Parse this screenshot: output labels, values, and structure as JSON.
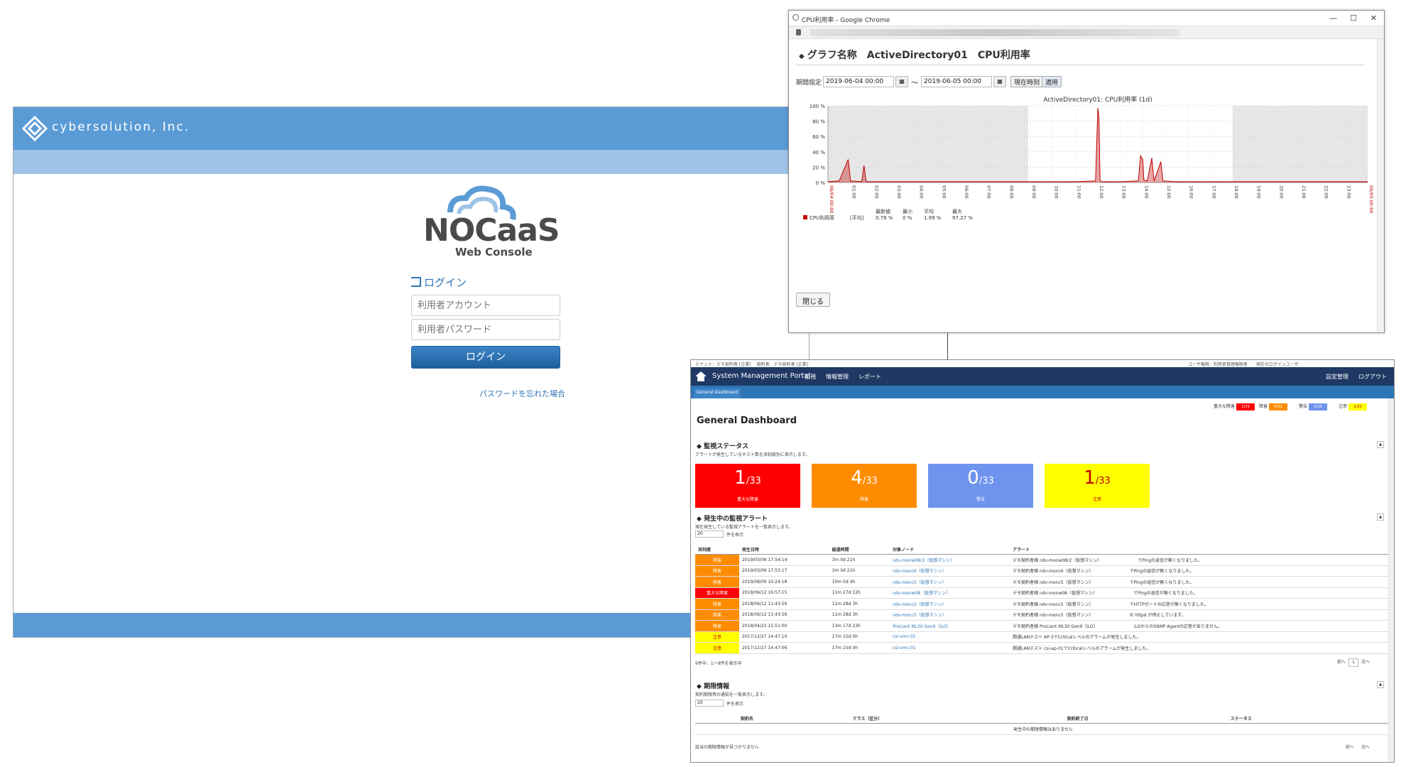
{
  "login": {
    "brand": "cybersolution, Inc.",
    "product": "NOCaaS",
    "product_sub": "Web Console",
    "heading": "ログイン",
    "account_placeholder": "利用者アカウント",
    "password_placeholder": "利用者パスワード",
    "login_button": "ログイン",
    "forgot_link": "パスワードを忘れた場合"
  },
  "popup": {
    "window_title": "CPU利用率 - Google Chrome",
    "heading": "グラフ名称　ActiveDirectory01　CPU利用率",
    "period_label": "期間指定",
    "from": "2019-06-04 00:00",
    "to": "2019-06-05 00:00",
    "tilde": "～",
    "now_button": "現在時刻",
    "apply_button": "適用",
    "close_button": "閉じる",
    "controls": {
      "minimize": "—",
      "maximize": "☐",
      "close": "✕"
    }
  },
  "chart_data": {
    "type": "line",
    "title": "ActiveDirectory01: CPU利用率 (1d)",
    "x": [
      "06/04 00:00",
      "01:00",
      "02:00",
      "03:00",
      "04:00",
      "05:00",
      "06:00",
      "07:00",
      "08:00",
      "09:00",
      "10:00",
      "11:00",
      "12:00",
      "13:00",
      "14:00",
      "15:00",
      "16:00",
      "17:00",
      "18:00",
      "19:00",
      "20:00",
      "21:00",
      "22:00",
      "23:00",
      "06/05 00:00"
    ],
    "yticks": [
      "0 %",
      "20 %",
      "40 %",
      "60 %",
      "80 %",
      "100 %"
    ],
    "ylim": [
      0,
      100
    ],
    "legend": {
      "series": "CPU利用率",
      "agg": "[平均]",
      "headers": [
        "最新値",
        "最小",
        "平均",
        "最大"
      ],
      "values": [
        "0.78 %",
        "0 %",
        "1.99 %",
        "97.27 %"
      ]
    },
    "series": [
      {
        "name": "CPU利用率",
        "color": "#c00000",
        "points": [
          [
            0,
            1
          ],
          [
            0.5,
            2
          ],
          [
            0.9,
            30
          ],
          [
            1.0,
            2
          ],
          [
            1.5,
            1
          ],
          [
            1.6,
            22
          ],
          [
            1.7,
            1
          ],
          [
            2,
            1
          ],
          [
            3,
            1
          ],
          [
            4,
            1
          ],
          [
            5,
            1
          ],
          [
            6,
            1
          ],
          [
            7,
            1
          ],
          [
            8,
            1
          ],
          [
            9,
            1
          ],
          [
            10,
            1
          ],
          [
            11,
            1
          ],
          [
            11.9,
            2
          ],
          [
            12.0,
            97
          ],
          [
            12.05,
            85
          ],
          [
            12.1,
            2
          ],
          [
            12.2,
            1
          ],
          [
            13,
            1
          ],
          [
            13.8,
            2
          ],
          [
            13.9,
            35
          ],
          [
            14.0,
            30
          ],
          [
            14.05,
            3
          ],
          [
            14.2,
            2
          ],
          [
            14.4,
            32
          ],
          [
            14.5,
            2
          ],
          [
            14.8,
            27
          ],
          [
            14.9,
            2
          ],
          [
            15.5,
            1
          ],
          [
            16,
            1
          ],
          [
            17,
            1
          ],
          [
            18,
            1
          ],
          [
            19,
            1
          ],
          [
            20,
            1
          ],
          [
            21,
            1
          ],
          [
            22,
            1
          ],
          [
            23,
            1
          ],
          [
            24,
            1
          ]
        ]
      }
    ],
    "shaded_ranges": [
      [
        0,
        8.9
      ],
      [
        18,
        24
      ]
    ]
  },
  "dashboard": {
    "topinfo_left": "テナント：デモ契約者 [企業] 　契約者：デモ契約者 [企業]",
    "topinfo_right": "ユーザ権限：利用者管理権限者　　現在のログインユーザ",
    "portal_title": "System Management Portal",
    "menu": [
      "監視",
      "情報管理",
      "レポート"
    ],
    "menu_right": [
      "設定管理",
      "ログアウト"
    ],
    "tab": "General Dashboard",
    "legend": [
      {
        "label": "重大な障害",
        "value": "1/33",
        "color": "#ff0000",
        "text": "#fff"
      },
      {
        "label": "障害",
        "value": "4/33",
        "color": "#ff8c00",
        "text": "#fff"
      },
      {
        "label": "警告",
        "value": "0/33",
        "color": "#6f94ee",
        "text": "#fff"
      },
      {
        "label": "注意",
        "value": "1/33",
        "color": "#ffff00",
        "text": "#c00000"
      }
    ],
    "title": "General Dashboard",
    "status_section": "監視ステータス",
    "status_note": "アラートが発生しているホスト数を深刻度別に表示します。",
    "kpis": [
      {
        "num": "1",
        "den": "/33",
        "label": "重大な障害",
        "color": "#ff0000",
        "text": "#ffffff"
      },
      {
        "num": "4",
        "den": "/33",
        "label": "障害",
        "color": "#ff8c00",
        "text": "#ffffff"
      },
      {
        "num": "0",
        "den": "/33",
        "label": "警告",
        "color": "#6f94ee",
        "text": "#ffffff"
      },
      {
        "num": "1",
        "den": "/33",
        "label": "注意",
        "color": "#ffff00",
        "text": "#c00000"
      }
    ],
    "alerts_section": "発生中の監視アラート",
    "alerts_note": "現在発生している監視アラートを一覧表示します。",
    "select_value": "20",
    "select_note": "件を表示",
    "alert_headers": [
      "深刻度",
      "発生日時",
      "経過時間",
      "対象ノード",
      "アラート"
    ],
    "alerts": [
      {
        "sev": "障害",
        "color": "#ff8c00",
        "text": "#fff",
        "date": "2019/03/06 17:54:14",
        "elapsed": "3m 0d 21h",
        "node": "ndv-monw08r2（仮想マシン）",
        "alert": "デモ契約者様 ndv-monw08r2（仮想マシン）　　　　　　　　　でPingの返信が無くなりました。"
      },
      {
        "sev": "障害",
        "color": "#ff8c00",
        "text": "#fff",
        "date": "2019/03/06 17:53:17",
        "elapsed": "3m 0d 21h",
        "node": "ndv-monc6（仮想マシン）",
        "alert": "デモ契約者様 ndv-monc6（仮想マシン）　　　　　　　　　でPingの返信が無くなりました。"
      },
      {
        "sev": "障害",
        "color": "#ff8c00",
        "text": "#fff",
        "date": "2019/08/09 10:24:18",
        "elapsed": "10m 0d 4h",
        "node": "ndv-monc5（仮想マシン）",
        "alert": "デモ契約者様 ndv-monc5（仮想マシン）　　　　　　　　　でPingの返信が無くなりました。"
      },
      {
        "sev": "重大な障害",
        "color": "#ff0000",
        "text": "#fff",
        "date": "2018/06/12 16:57:15",
        "elapsed": "11m 27d 22h",
        "node": "ndv-monw08（仮想マシン）",
        "alert": "デモ契約者様 ndv-monw08（仮想マシン）　　　　　　　　　でPingの返信が無くなりました。"
      },
      {
        "sev": "障害",
        "color": "#ff8c00",
        "text": "#fff",
        "date": "2018/06/12 11:43:56",
        "elapsed": "11m 28d 3h",
        "node": "ndv-monc5（仮想マシン）",
        "alert": "デモ契約者様 ndv-monc5（仮想マシン）　　　　　　　　　でHTTPポートの応答が無くなりました。"
      },
      {
        "sev": "障害",
        "color": "#ff8c00",
        "text": "#fff",
        "date": "2018/06/12 11:43:56",
        "elapsed": "11m 28d 3h",
        "node": "ndv-monc5（仮想マシン）",
        "alert": "デモ契約者様 ndv-monc5（仮想マシン）　　　　　　　　　の httpd が停止しています。"
      },
      {
        "sev": "障害",
        "color": "#ff8c00",
        "text": "#fff",
        "date": "2018/04/23 15:51:00",
        "elapsed": "13m 17d 23h",
        "node": "ProLiant ML30 Gen9（iLO）",
        "alert": "デモ契約者様 ProLiant ML30 Gen9（iLO）　　　　　　　　　iLOからのSNMP Agentの応答がありません。"
      },
      {
        "sev": "注意",
        "color": "#ffff00",
        "text": "#c00000",
        "date": "2017/12/27 14:47:10",
        "elapsed": "17m 15d 0h",
        "node": "csi-vmc-01",
        "alert": "開通LANテスト AP-3でCriticalレベルのアラームが発生しました。"
      },
      {
        "sev": "注意",
        "color": "#ffff00",
        "text": "#c00000",
        "date": "2017/12/27 14:47:06",
        "elapsed": "17m 15d 0h",
        "node": "csi-vmc-01",
        "alert": "開通LANテスト csi-ap-01でCriticalレベルのアラームが発生しました。"
      }
    ],
    "alerts_footer": "9件中、1〜9件を表示中",
    "pager": {
      "prev": "前へ",
      "page": "1",
      "next": "次へ"
    },
    "contract_section": "期限情報",
    "contract_note": "契約期限等の通知を一覧表示します。",
    "contract_headers": [
      "契約名",
      "クラス（区分）",
      "契約終了日",
      "ステータス"
    ],
    "contract_empty": "発生中の期限情報はありません",
    "contract_footer": "該当の期限情報が見つかりません"
  }
}
